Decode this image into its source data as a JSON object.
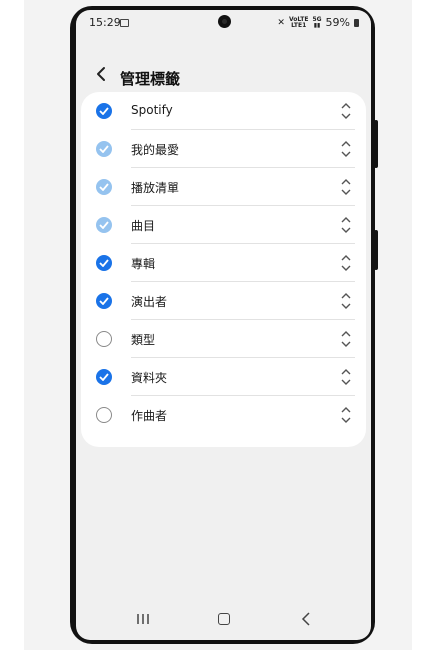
{
  "status_bar": {
    "time": "15:29",
    "network_top": "VoLTE",
    "network_bottom": "5G",
    "battery": "59%"
  },
  "header": {
    "title": "管理標籤"
  },
  "tags": [
    {
      "label": "Spotify",
      "state": "checked"
    },
    {
      "label": "我的最愛",
      "state": "checked-disabled"
    },
    {
      "label": "播放清單",
      "state": "checked-disabled"
    },
    {
      "label": "曲目",
      "state": "checked-disabled"
    },
    {
      "label": "專輯",
      "state": "checked"
    },
    {
      "label": "演出者",
      "state": "checked"
    },
    {
      "label": "類型",
      "state": "unchecked"
    },
    {
      "label": "資料夾",
      "state": "checked"
    },
    {
      "label": "作曲者",
      "state": "unchecked"
    }
  ],
  "colors": {
    "accent": "#1a73e8",
    "accent_disabled": "#95c3ef"
  }
}
